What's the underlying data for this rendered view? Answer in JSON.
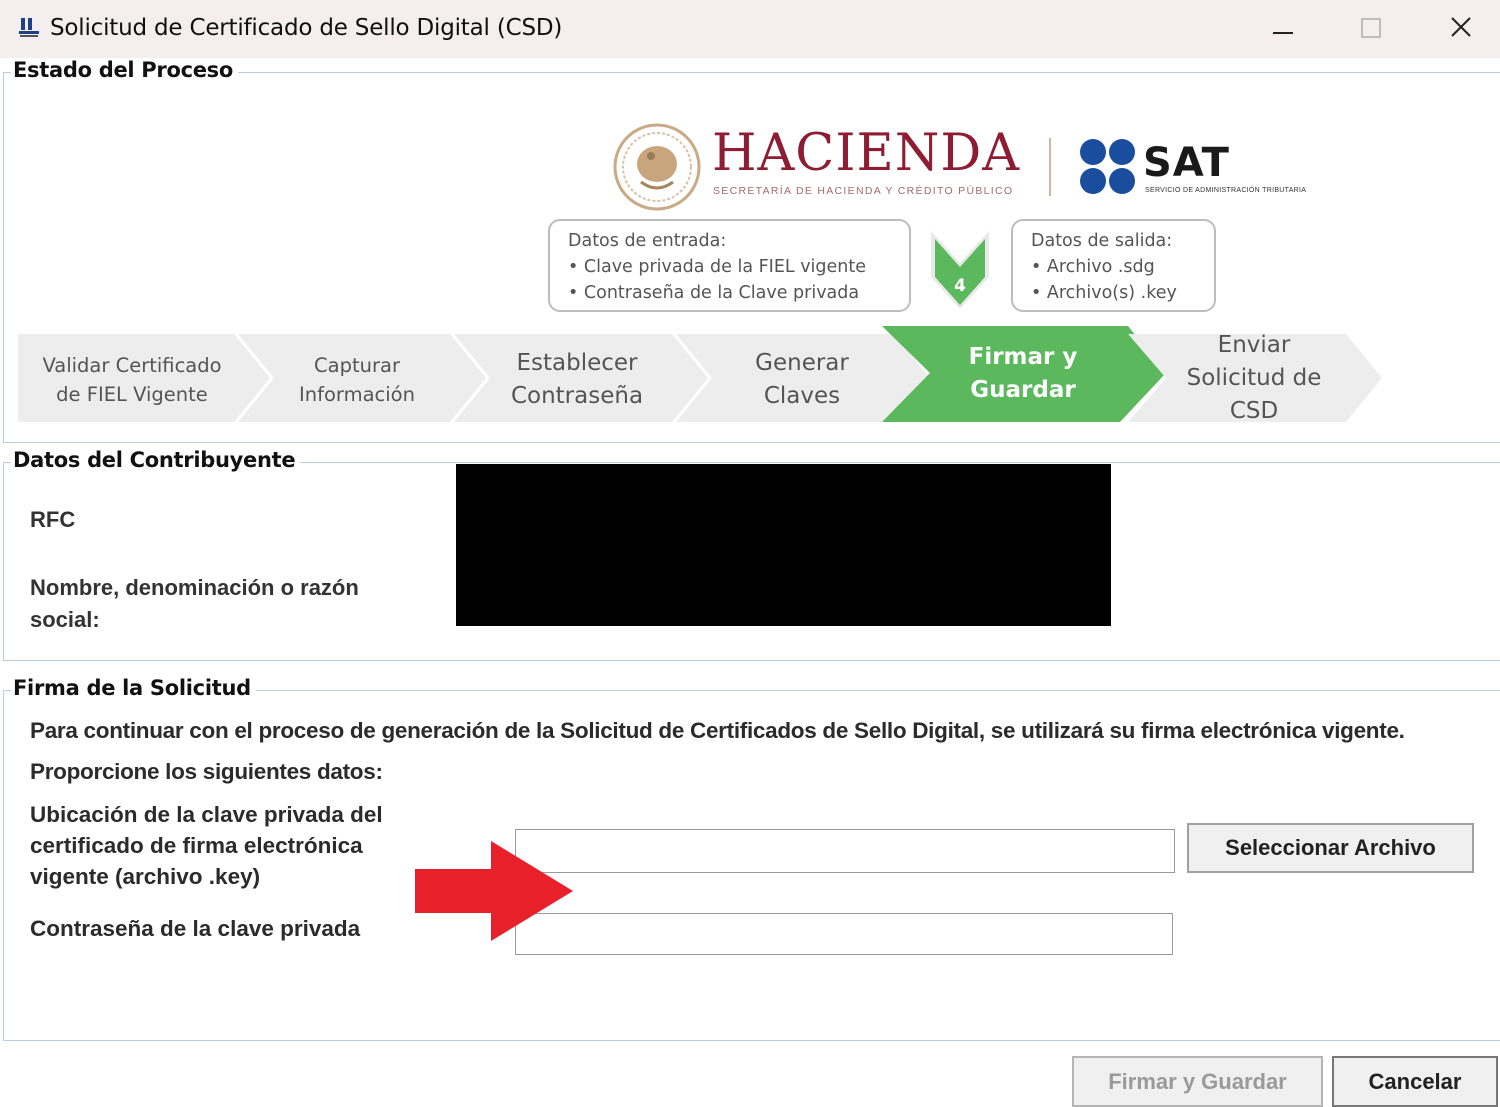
{
  "window": {
    "title": "Solicitud de Certificado de Sello Digital (CSD)",
    "icon": "app-logo-icon",
    "controls": [
      "minimize-icon",
      "maximize-icon",
      "close-icon"
    ]
  },
  "proceso": {
    "legend": "Estado del Proceso",
    "logos": {
      "hacienda": "HACIENDA",
      "hacienda_sub": "SECRETARÍA DE HACIENDA Y CRÉDITO PÚBLICO",
      "sat": "SAT",
      "sat_sub": "SERVICIO DE ADMINISTRACIÓN TRIBUTARIA"
    },
    "entrada": {
      "title": "Datos de entrada:",
      "items": [
        "Clave privada de la FIEL vigente",
        "Contraseña de la Clave privada"
      ]
    },
    "salida": {
      "title": "Datos de salida:",
      "items": [
        "Archivo .sdg",
        "Archivo(s) .key"
      ]
    },
    "current_step_number": "4",
    "steps": [
      {
        "label": "Validar Certificado de FIEL Vigente",
        "active": false
      },
      {
        "label": "Capturar Información",
        "active": false
      },
      {
        "label": "Establecer Contraseña",
        "active": false
      },
      {
        "label": "Generar Claves",
        "active": false
      },
      {
        "label": "Firmar y Guardar",
        "active": true
      },
      {
        "label": "Enviar Solicitud de CSD",
        "active": false
      }
    ],
    "colors": {
      "active": "#5cb85c",
      "inactive": "#ededed",
      "inactive_text": "#555555"
    }
  },
  "contribuyente": {
    "legend": "Datos del Contribuyente",
    "rfc_label": "RFC",
    "nombre_label": "Nombre, denominación o razón social:"
  },
  "firma": {
    "legend": "Firma de la Solicitud",
    "intro": "Para continuar con el proceso de generación de la Solicitud de Certificados de Sello Digital, se utilizará su firma electrónica vigente.",
    "prompt": "Proporcione los siguientes datos:",
    "key_label": "Ubicación de la clave privada del certificado de firma electrónica vigente (archivo .key)",
    "key_value": "",
    "password_label": "Contraseña de la clave privada",
    "password_value": "",
    "select_button": "Seleccionar Archivo"
  },
  "footer": {
    "firmar_button": "Firmar y Guardar",
    "cancel_button": "Cancelar"
  }
}
